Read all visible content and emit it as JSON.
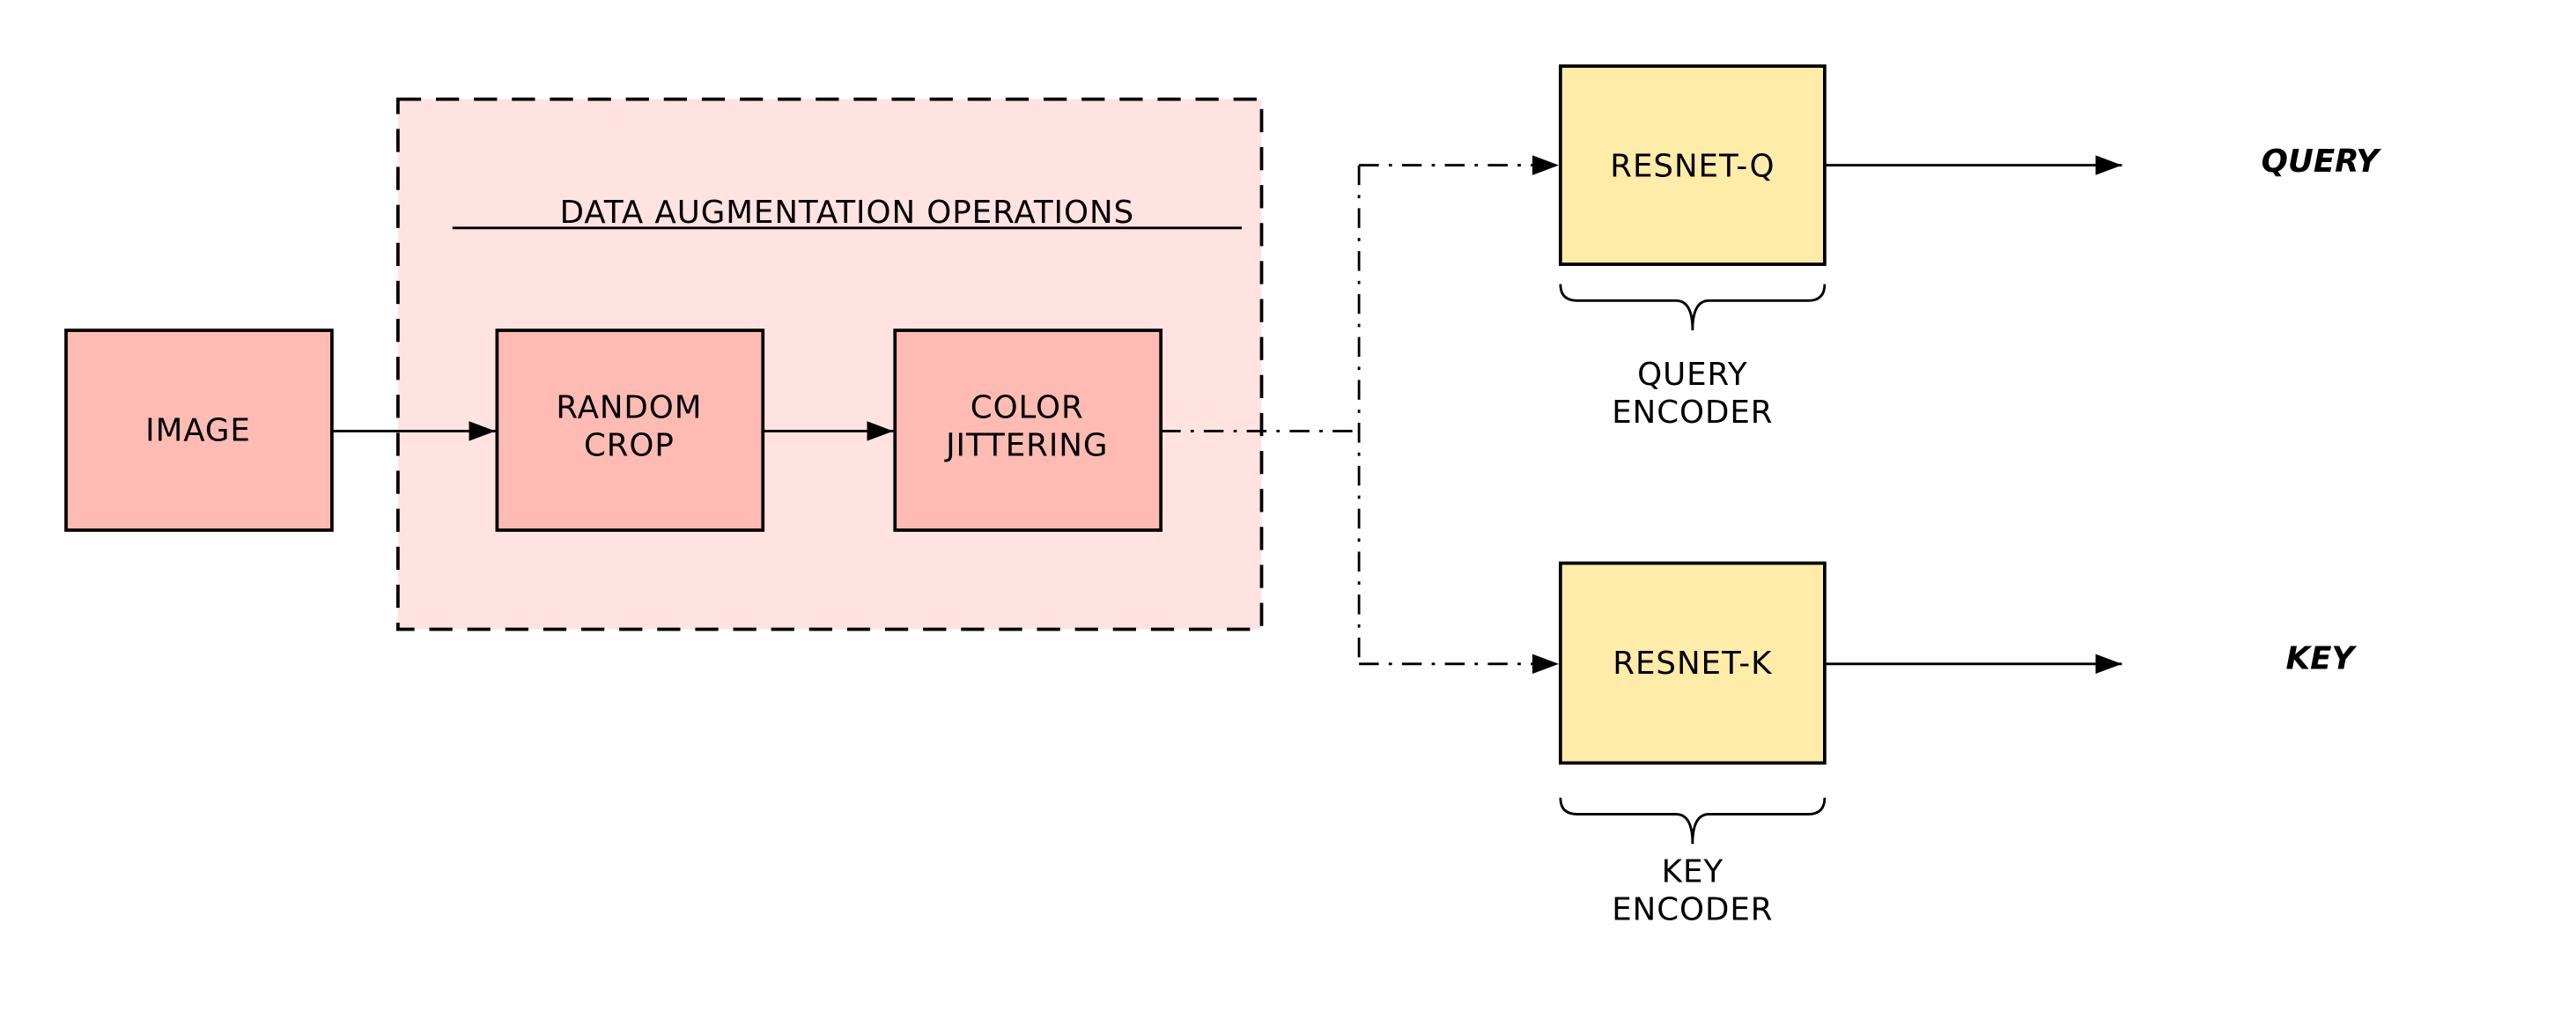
{
  "colors": {
    "augmentation_region": "#fee3e1",
    "augmentation_box": "#fdbbb3",
    "encoder_box": "#ffeca8",
    "stroke": "#000000"
  },
  "group": {
    "title": "DATA AUGMENTATION OPERATIONS"
  },
  "nodes": {
    "image": {
      "lines": [
        "IMAGE"
      ]
    },
    "random_crop": {
      "lines": [
        "RANDOM",
        "CROP"
      ]
    },
    "color_jittering": {
      "lines": [
        "COLOR",
        "JITTERING"
      ]
    },
    "resnet_q": {
      "lines": [
        "RESNET-Q"
      ]
    },
    "resnet_k": {
      "lines": [
        "RESNET-K"
      ]
    }
  },
  "braces": {
    "query_encoder": {
      "lines": [
        "QUERY",
        "ENCODER"
      ]
    },
    "key_encoder": {
      "lines": [
        "KEY",
        "ENCODER"
      ]
    }
  },
  "outputs": {
    "query": "QUERY",
    "key": "KEY"
  },
  "edges": [
    {
      "from": "image",
      "to": "random_crop",
      "style": "solid"
    },
    {
      "from": "random_crop",
      "to": "color_jittering",
      "style": "solid"
    },
    {
      "from": "color_jittering",
      "to": "resnet_q",
      "style": "dash-dot"
    },
    {
      "from": "color_jittering",
      "to": "resnet_k",
      "style": "dash-dot"
    },
    {
      "from": "resnet_q",
      "to": "query",
      "style": "solid"
    },
    {
      "from": "resnet_k",
      "to": "key",
      "style": "solid"
    }
  ]
}
